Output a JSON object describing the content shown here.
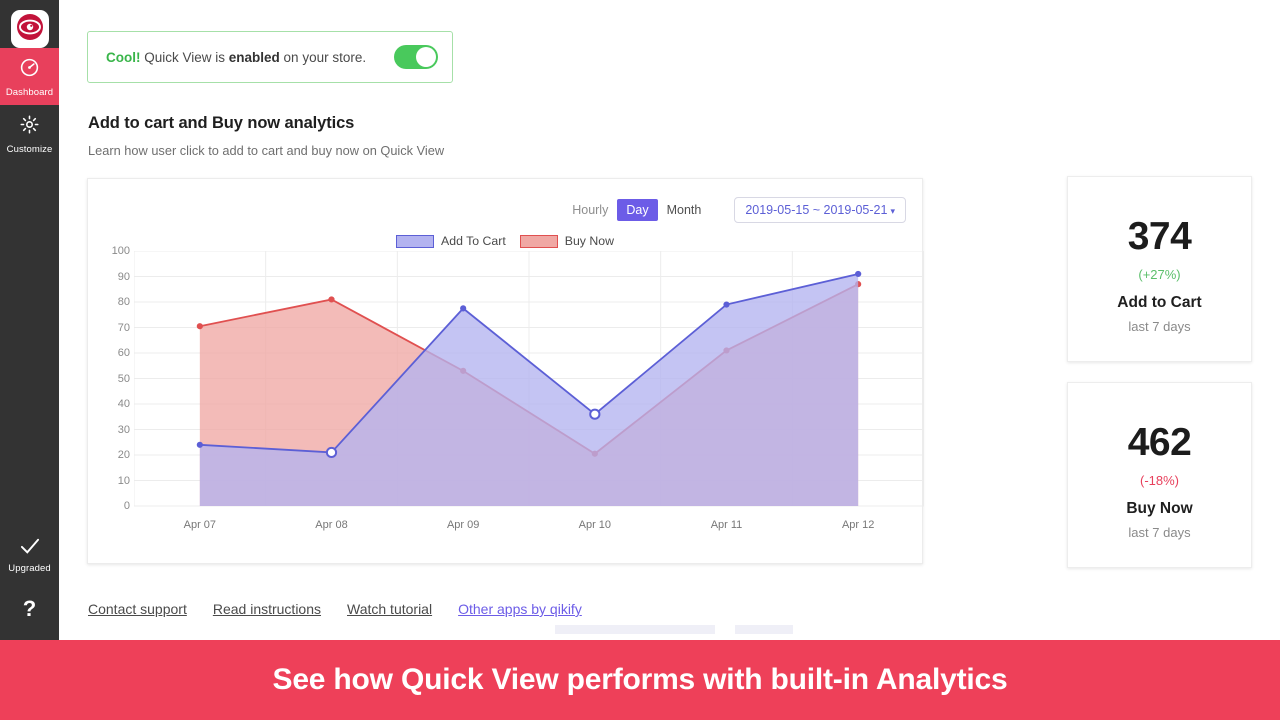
{
  "colors": {
    "sidebar_bg": "#333333",
    "accent_pink": "#e8405c",
    "banner_bg": "#ee4059",
    "purple": "#6c5ce7",
    "add_to_cart_line": "#5c5fd6",
    "add_to_cart_fill": "#b3b3f0",
    "buy_now_line": "#e05050",
    "buy_now_fill": "#f0a8a4",
    "green": "#39b54a",
    "up_green": "#5cbf6b",
    "down_red": "#e8405c"
  },
  "sidebar": {
    "logo_icon": "eye-logo-icon",
    "items": [
      {
        "label": "Dashboard",
        "icon": "dashboard-gauge-icon",
        "active": true
      },
      {
        "label": "Customize",
        "icon": "gear-icon",
        "active": false
      }
    ],
    "bottom": {
      "upgraded_label": "Upgraded",
      "upgraded_icon": "check-icon",
      "help_label": "?",
      "help_icon": "question-mark-icon"
    }
  },
  "alert": {
    "prefix": "Cool!",
    "middle_before": " Quick View is ",
    "bold_word": "enabled",
    "middle_after": " on your store.",
    "toggle_on": true,
    "toggle_name": "quick-view-enabled-toggle"
  },
  "section": {
    "title": "Add to cart and Buy now analytics",
    "subtitle": "Learn how user click to add to cart and buy now on Quick View"
  },
  "chart_controls": {
    "granularity_options": [
      "Hourly",
      "Day",
      "Month"
    ],
    "granularity_selected": "Day",
    "date_range": "2019-05-15 ~ 2019-05-21",
    "date_caret": "▾"
  },
  "chart_data": {
    "type": "area",
    "title": "",
    "subtitle": "",
    "xlabel": "",
    "ylabel": "",
    "categories": [
      "Apr 07",
      "Apr 08",
      "Apr 09",
      "Apr 10",
      "Apr 11",
      "Apr 12"
    ],
    "yticks": [
      0,
      10,
      20,
      30,
      40,
      50,
      60,
      70,
      80,
      90,
      100
    ],
    "ylim": [
      0,
      100
    ],
    "grid": true,
    "legend_position": "top-center",
    "series": [
      {
        "name": "Add To Cart",
        "values": [
          24,
          21,
          77.5,
          36,
          79,
          91
        ]
      },
      {
        "name": "Buy Now",
        "values": [
          70.5,
          81,
          53,
          20.5,
          61,
          87
        ]
      }
    ]
  },
  "stats": [
    {
      "value": "374",
      "delta": "(+27%)",
      "delta_dir": "up",
      "label": "Add to Cart",
      "period": "last 7 days"
    },
    {
      "value": "462",
      "delta": "(-18%)",
      "delta_dir": "down",
      "label": "Buy Now",
      "period": "last 7 days"
    }
  ],
  "footer_links": [
    {
      "label": "Contact support",
      "accent": false
    },
    {
      "label": "Read instructions",
      "accent": false
    },
    {
      "label": "Watch tutorial",
      "accent": false
    },
    {
      "label": "Other apps by qikify",
      "accent": true
    }
  ],
  "banner": {
    "text": "See how Quick View performs with built-in Analytics"
  }
}
